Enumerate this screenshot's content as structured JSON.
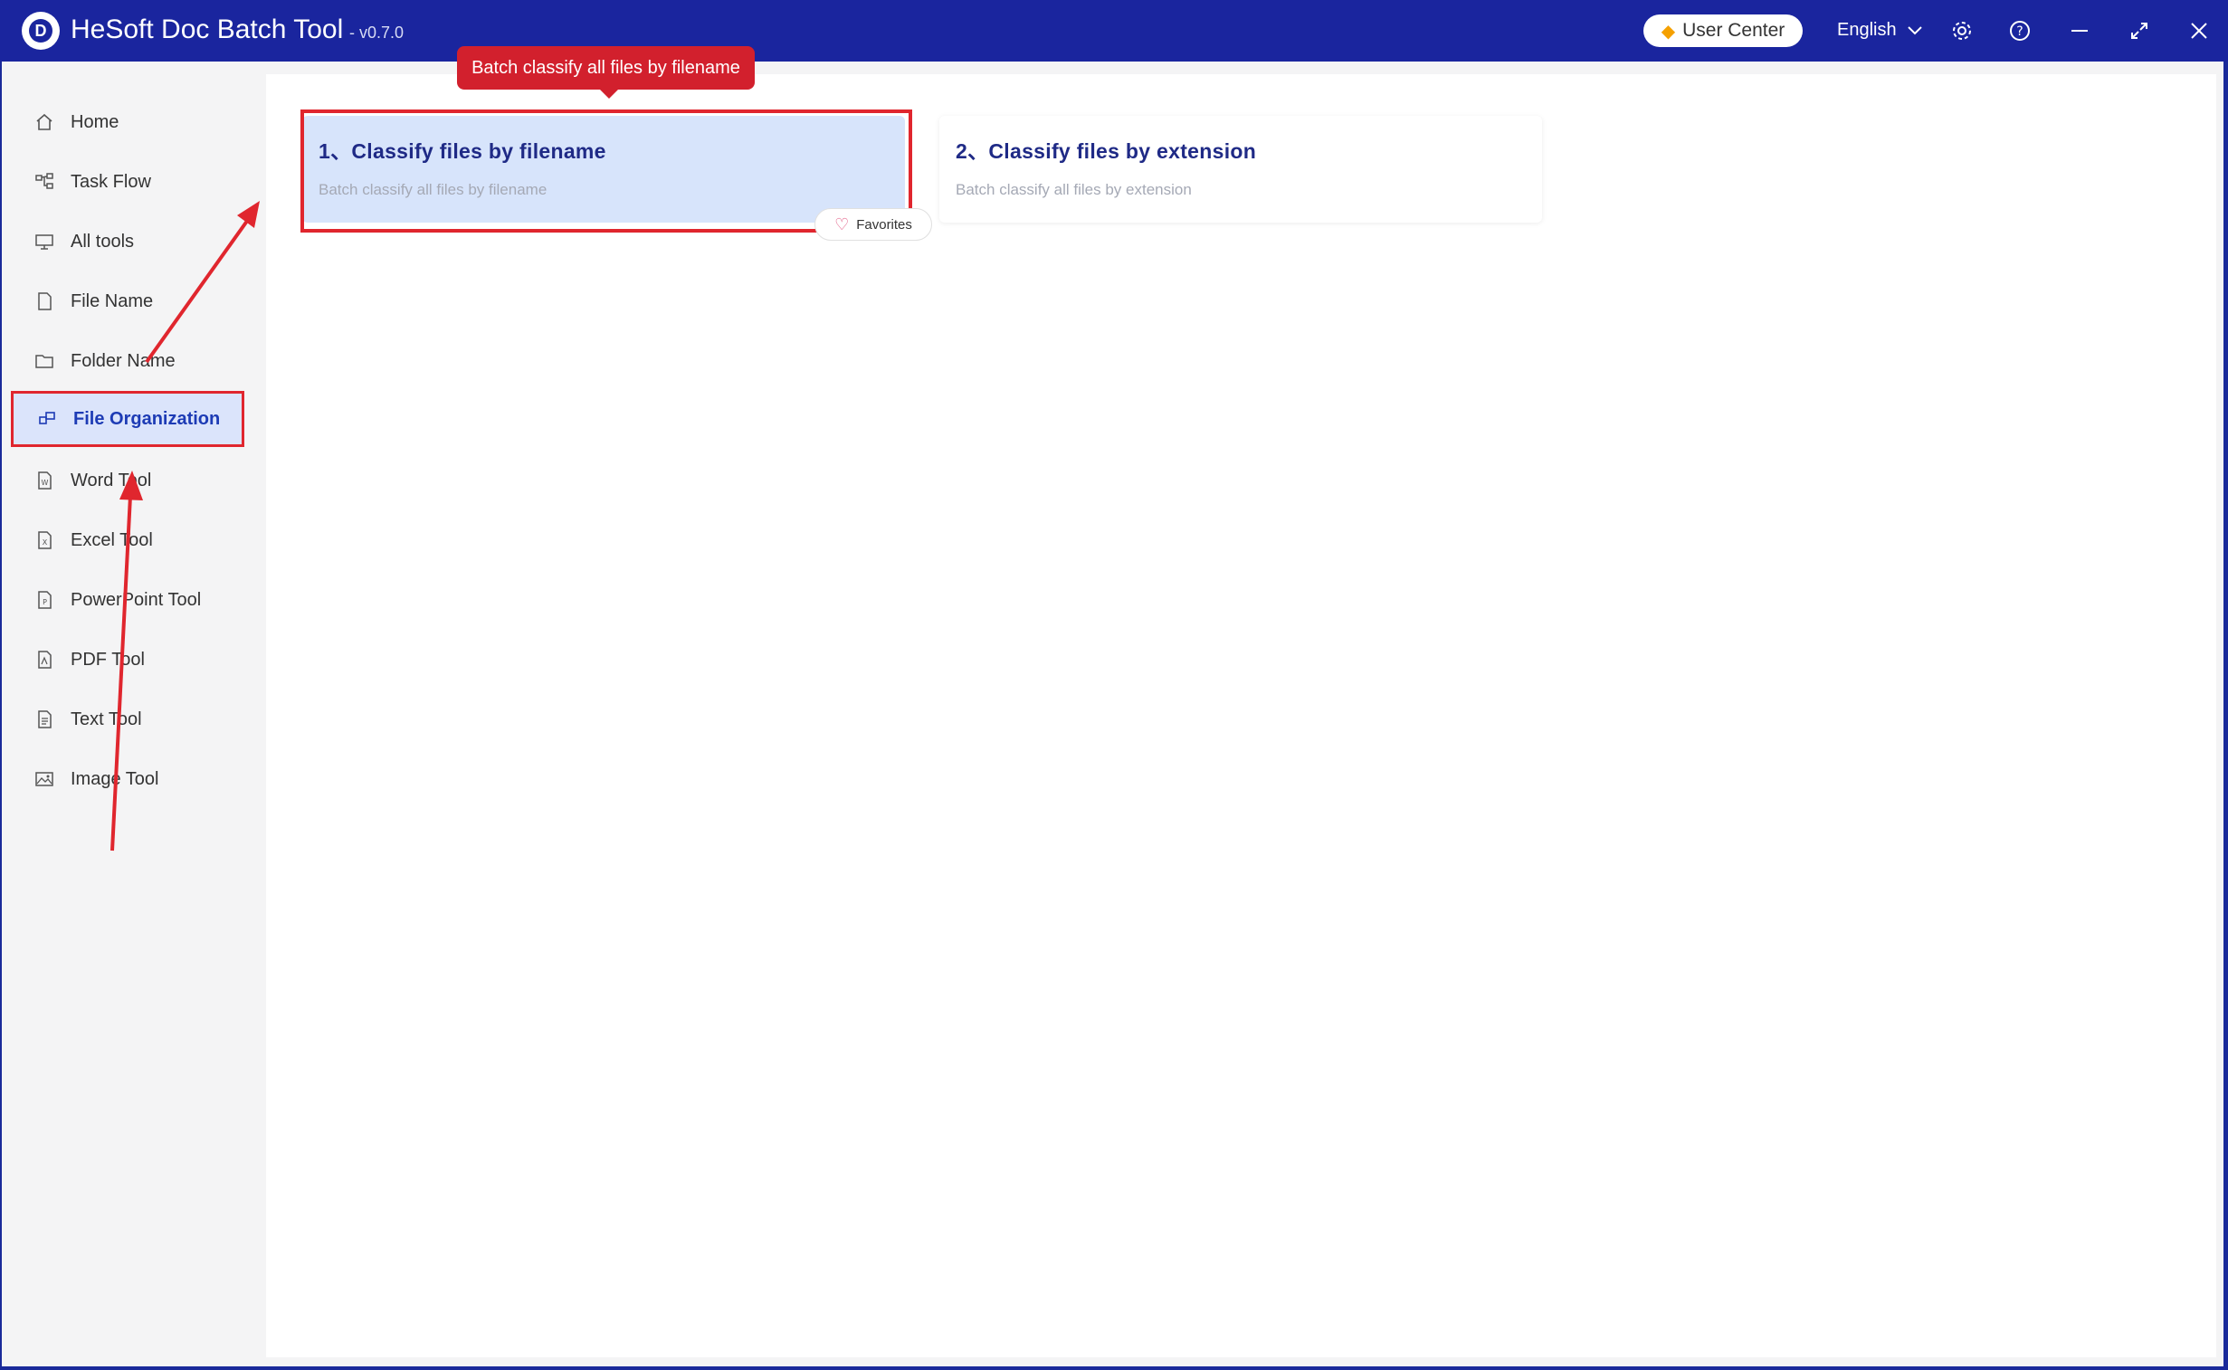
{
  "titlebar": {
    "logo_letter": "D",
    "app_title": "HeSoft Doc Batch Tool",
    "version": "- v0.7.0",
    "user_center": "User Center",
    "language": "English",
    "icons": [
      "settings-icon",
      "help-icon",
      "minimize-icon",
      "maximize-icon",
      "close-icon"
    ]
  },
  "sidebar": {
    "items": [
      {
        "label": "Home",
        "icon": "home-icon"
      },
      {
        "label": "Task Flow",
        "icon": "task-flow-icon"
      },
      {
        "label": "All tools",
        "icon": "monitor-icon"
      },
      {
        "label": "File Name",
        "icon": "file-icon"
      },
      {
        "label": "Folder Name",
        "icon": "folder-icon"
      },
      {
        "label": "File Organization",
        "icon": "organize-icon",
        "active": true
      },
      {
        "label": "Word Tool",
        "icon": "word-icon"
      },
      {
        "label": "Excel Tool",
        "icon": "excel-icon"
      },
      {
        "label": "PowerPoint Tool",
        "icon": "powerpoint-icon"
      },
      {
        "label": "PDF Tool",
        "icon": "pdf-icon"
      },
      {
        "label": "Text Tool",
        "icon": "text-icon"
      },
      {
        "label": "Image Tool",
        "icon": "image-icon"
      }
    ]
  },
  "main": {
    "tooltip": "Batch classify all files by filename",
    "cards": [
      {
        "title": "1、Classify files by filename",
        "desc": "Batch classify all files by filename"
      },
      {
        "title": "2、Classify files by extension",
        "desc": "Batch classify all files by extension"
      }
    ],
    "favorites": "Favorites"
  },
  "colors": {
    "titlebar": "#1a259e",
    "accent": "#1d3bb5",
    "highlight_red": "#e0262e",
    "card_selected": "#d7e4fb"
  }
}
